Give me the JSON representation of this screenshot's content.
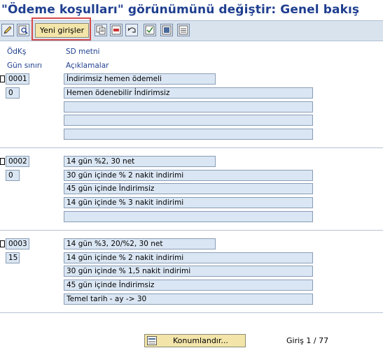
{
  "title": "\"Ödeme koşulları\" görünümünü değiştir: Genel bakış",
  "toolbar": {
    "new_entries_label": "Yeni girişler",
    "icons": [
      "edit-icon",
      "details-icon",
      "copy-icon",
      "delete-icon",
      "undo-icon",
      "select-all-icon",
      "select-block-icon",
      "deselect-all-icon"
    ]
  },
  "headers": {
    "col1_row1": "ÖdKş",
    "col2_row1": "SD metni",
    "col1_row2": "Gün sınırı",
    "col2_row2": "Açıklamalar"
  },
  "groups": [
    {
      "code": "0001",
      "day_limit": "0",
      "sd_text": "İndirimsiz hemen ödemeli",
      "descriptions": [
        "Hemen ödenebilir İndirimsiz",
        "",
        "",
        ""
      ]
    },
    {
      "code": "0002",
      "day_limit": "0",
      "sd_text": "14 gün %2, 30 net",
      "descriptions": [
        "30 gün içinde % 2 nakit indirimi",
        "45 gün içinde İndirimsiz",
        "14 gün içinde % 3 nakit indirimi",
        ""
      ]
    },
    {
      "code": "0003",
      "day_limit": "15",
      "sd_text": "14 gün %3, 20/%2, 30 net",
      "descriptions": [
        "14 gün içinde % 2 nakit indirimi",
        "30 gün içinde % 1,5 nakit indirimi",
        "45 gün içinde İndirimsiz",
        "Temel tarih - ay -> 30"
      ]
    }
  ],
  "footer": {
    "position_button_label": "Konumlandır...",
    "entry_label": "Giriş",
    "entry_value": "1 / 77"
  }
}
